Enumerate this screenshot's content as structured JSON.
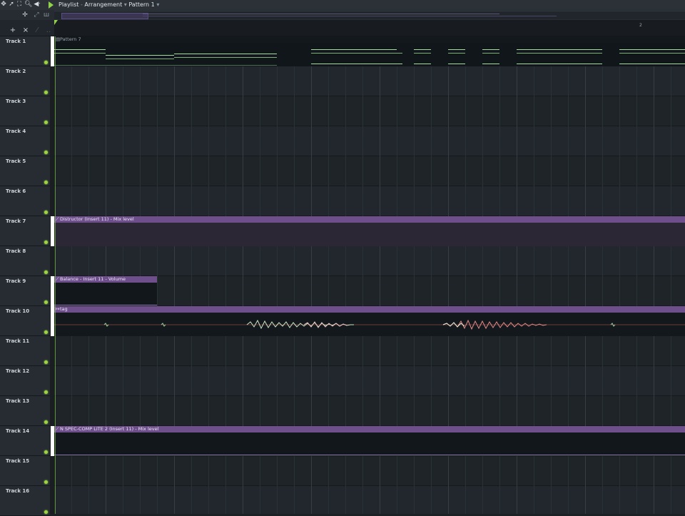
{
  "window": {
    "title_app": "Playlist",
    "title_sep1": "-",
    "title_view": "Arrangement",
    "title_arrow1": "▾",
    "title_pattern": "Pattern 1",
    "title_arrow2": "▾"
  },
  "ruler": {
    "bar_marker": "2"
  },
  "colors": {
    "accent_green": "#8fd34a",
    "clip_purple": "#6e4f8c",
    "note_green": "#a6dca0",
    "wave_red": "#e08a86"
  },
  "tracks": [
    {
      "name": "Track 1"
    },
    {
      "name": "Track 2"
    },
    {
      "name": "Track 3"
    },
    {
      "name": "Track 4"
    },
    {
      "name": "Track 5"
    },
    {
      "name": "Track 6"
    },
    {
      "name": "Track 7"
    },
    {
      "name": "Track 8"
    },
    {
      "name": "Track 9"
    },
    {
      "name": "Track 10"
    },
    {
      "name": "Track 11"
    },
    {
      "name": "Track 12"
    },
    {
      "name": "Track 13"
    },
    {
      "name": "Track 14"
    },
    {
      "name": "Track 15"
    },
    {
      "name": "Track 16"
    }
  ],
  "clips": {
    "pattern7": {
      "label": "Pattern 7",
      "icon": "pattern-icon"
    },
    "distructor": {
      "label": "Distructor (Insert 11) - Mix level",
      "icon": "automation-icon"
    },
    "balance": {
      "label": "Balance - Insert 11 - Volume",
      "icon": "automation-icon"
    },
    "tag": {
      "label": "tag",
      "icon": "audio-clip-icon"
    },
    "speccomp": {
      "label": "N SPEC-COMP LITE 2 (Insert 11) - Mix level",
      "icon": "automation-icon"
    }
  }
}
